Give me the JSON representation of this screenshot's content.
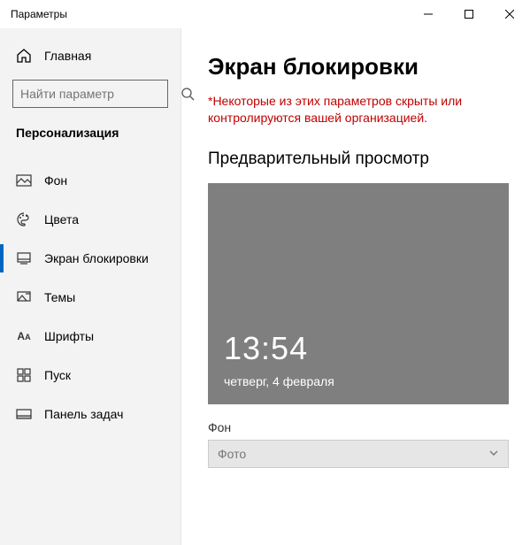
{
  "window": {
    "title": "Параметры"
  },
  "sidebar": {
    "home": "Главная",
    "searchPlaceholder": "Найти параметр",
    "section": "Персонализация",
    "items": [
      {
        "label": "Фон"
      },
      {
        "label": "Цвета"
      },
      {
        "label": "Экран блокировки"
      },
      {
        "label": "Темы"
      },
      {
        "label": "Шрифты"
      },
      {
        "label": "Пуск"
      },
      {
        "label": "Панель задач"
      }
    ]
  },
  "page": {
    "title": "Экран блокировки",
    "warning": "*Некоторые из этих параметров скрыты или контролируются вашей организацией.",
    "previewHeading": "Предварительный просмотр",
    "preview": {
      "time": "13:54",
      "date": "четверг, 4 февраля"
    },
    "backgroundLabel": "Фон",
    "backgroundValue": "Фото"
  }
}
